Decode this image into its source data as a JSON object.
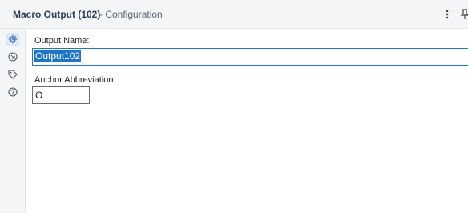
{
  "header": {
    "title": "Macro Output (102)",
    "subtitle": "- Configuration",
    "menu_icon": "more-vertical-icon",
    "pin_icon": "pin-icon"
  },
  "side_rail": {
    "items": [
      {
        "icon": "gear-icon",
        "active": true
      },
      {
        "icon": "arrow-in-circle-icon",
        "active": false
      },
      {
        "icon": "tag-icon",
        "active": false
      },
      {
        "icon": "help-circle-icon",
        "active": false
      }
    ]
  },
  "form": {
    "output_name_label": "Output Name:",
    "output_name_value": "Output102",
    "anchor_label": "Anchor Abbreviation:",
    "anchor_value": "O"
  },
  "colors": {
    "accent": "#1e74c9",
    "header_bg": "#f4f5f7"
  }
}
